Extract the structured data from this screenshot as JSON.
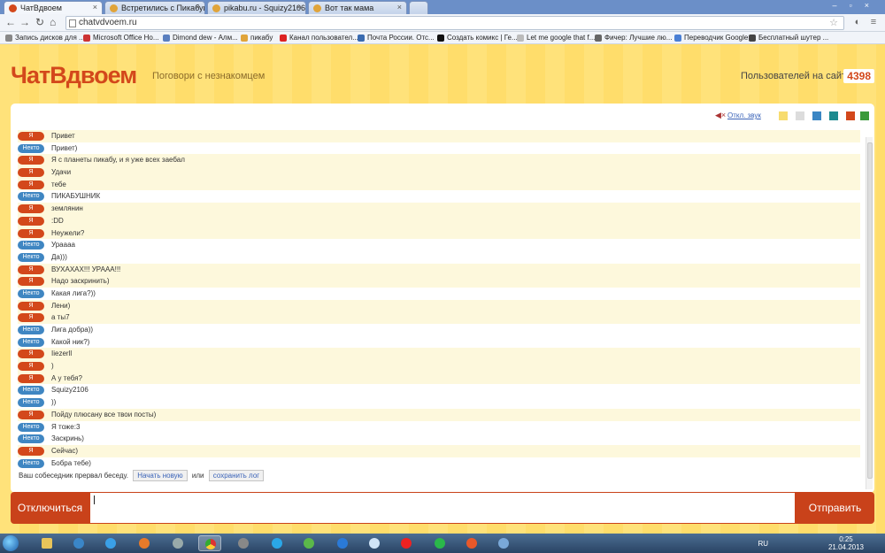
{
  "browser": {
    "tabs": [
      {
        "title": "ЧатВдвоем",
        "active": true
      },
      {
        "title": "Встретились с Пикабуш",
        "active": false
      },
      {
        "title": "pikabu.ru - Squizy2106",
        "active": false
      },
      {
        "title": "Вот так мама",
        "active": false
      }
    ],
    "url": "chatvdvoem.ru",
    "bookmarks": [
      "Запись дисков для ...",
      "Microsoft Office Ho...",
      "Dimond dew - Алм...",
      "пикабу",
      "Канал пользовател...",
      "Почта России. Отс...",
      "Создать комикс | Ге...",
      "Let me google that f...",
      "Фичер: Лучшие лю...",
      "Переводчик Google",
      "Бесплатный шутер ..."
    ]
  },
  "header": {
    "logo": "ЧатВдвоем",
    "slogan": "Поговори с незнакомцем",
    "users_label": "Пользователей на сайте",
    "users_count": "4398"
  },
  "toolbar": {
    "sound_label": "Откл. звук",
    "swatches": [
      "#f7dc6f",
      "#dcdcdc",
      "#3b86c4",
      "#1d8a8f",
      "#d3481b",
      "#3a9a3a"
    ]
  },
  "labels": {
    "me": "Я",
    "other": "Некто"
  },
  "messages": [
    {
      "who": "me",
      "text": "Привет"
    },
    {
      "who": "other",
      "text": "Привет)"
    },
    {
      "who": "me",
      "text": "Я с планеты пикабу, и я уже всех заебал"
    },
    {
      "who": "me",
      "text": "Удачи"
    },
    {
      "who": "me",
      "text": "тебе"
    },
    {
      "who": "other",
      "text": "ПИКАБУШНИК"
    },
    {
      "who": "me",
      "text": "землянин"
    },
    {
      "who": "me",
      "text": ":DD"
    },
    {
      "who": "me",
      "text": "Неужели?"
    },
    {
      "who": "other",
      "text": "Урaaaa"
    },
    {
      "who": "other",
      "text": "Да)))"
    },
    {
      "who": "me",
      "text": "ВУХАХАХ!!! УРААА!!!"
    },
    {
      "who": "me",
      "text": "Надо заскринить)"
    },
    {
      "who": "other",
      "text": "Какая лига?))"
    },
    {
      "who": "me",
      "text": "Лени)"
    },
    {
      "who": "me",
      "text": "а ты7"
    },
    {
      "who": "other",
      "text": "Лига добра))"
    },
    {
      "who": "other",
      "text": "Какой ник?)"
    },
    {
      "who": "me",
      "text": "Iiezerll"
    },
    {
      "who": "me",
      "text": ")"
    },
    {
      "who": "me",
      "text": "А у тебя?"
    },
    {
      "who": "other",
      "text": "Squizy2106"
    },
    {
      "who": "other",
      "text": "))"
    },
    {
      "who": "me",
      "text": "Пойду плюсану все твои посты)"
    },
    {
      "who": "other",
      "text": "Я тоже:3"
    },
    {
      "who": "other",
      "text": "Заскринь)"
    },
    {
      "who": "me",
      "text": "Сейчас)"
    },
    {
      "who": "other",
      "text": "Бобра тебе)"
    }
  ],
  "end_notice": {
    "text": "Ваш собеседник прервал беседу.",
    "new_chat": "Начать новую",
    "or": "или",
    "save_log": "сохранить лог"
  },
  "bottom": {
    "disconnect": "Отключиться",
    "send": "Отправить",
    "input_value": ""
  },
  "taskbar": {
    "lang": "RU",
    "time": "0:25",
    "date": "21.04.2013"
  }
}
